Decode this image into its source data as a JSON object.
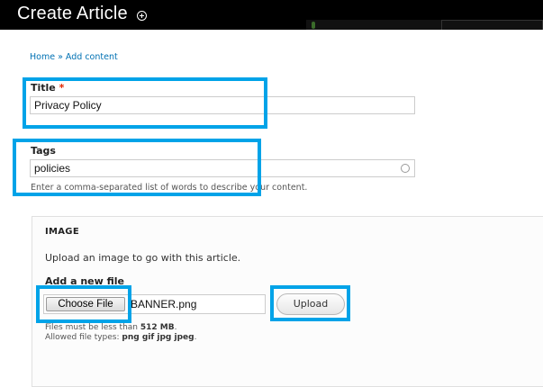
{
  "header": {
    "title": "Create Article"
  },
  "breadcrumb": "Home » Add content",
  "title_field": {
    "label": "Title",
    "required_mark": "*",
    "value": "Privacy Policy"
  },
  "tags_field": {
    "label": "Tags",
    "value": "policies",
    "description": "Enter a comma-separated list of words to describe your content."
  },
  "image_fieldset": {
    "legend": "IMAGE",
    "help": "Upload an image to go with this article.",
    "add_label": "Add a new file",
    "choose_button": "Choose File",
    "file_name": "BANNER.png",
    "upload_button": "Upload",
    "max_size_prefix": "Files must be less than ",
    "max_size": "512 MB",
    "max_size_suffix": ".",
    "types_prefix": "Allowed file types: ",
    "types": "png gif jpg jpeg",
    "types_suffix": "."
  },
  "colors": {
    "highlight": "#00a3e8",
    "link": "#0071b3",
    "required": "#e32700"
  }
}
